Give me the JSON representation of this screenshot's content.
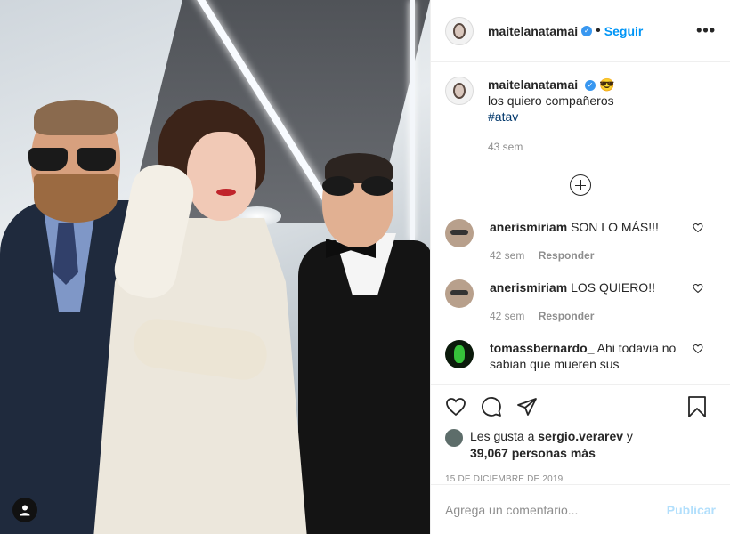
{
  "post": {
    "username": "maitelanatamai",
    "follow_label": "Seguir",
    "more_label": "•••",
    "caption_emoji": "😎",
    "caption_text": "los quiero compañeros",
    "hashtag": "#atav",
    "caption_time": "43 sem"
  },
  "comments": [
    {
      "username": "anerismiriam",
      "text": "SON LO MÁS!!!",
      "time": "42 sem",
      "reply_label": "Responder"
    },
    {
      "username": "anerismiriam",
      "text": "LOS QUIERO!!",
      "time": "42 sem",
      "reply_label": "Responder"
    },
    {
      "username": "tomassbernardo_",
      "text": "Ahi todavia no sabian que mueren sus",
      "time": "",
      "reply_label": ""
    }
  ],
  "likes": {
    "prefix": "Les gusta a",
    "liker": "sergio.verarev",
    "connector": "y",
    "count": "39,067 personas más"
  },
  "date": "15 DE DICIEMBRE DE 2019",
  "add_comment": {
    "placeholder": "Agrega un comentario...",
    "publish_label": "Publicar"
  },
  "icons": [
    "heart-icon",
    "comment-icon",
    "share-icon",
    "bookmark-icon",
    "user-tag-icon",
    "plus-circle-icon",
    "verified-icon"
  ],
  "colors": {
    "accent": "#0095f6",
    "verified": "#3897f0",
    "publish_disabled": "#b2dffc",
    "meta": "#8e8e8e"
  }
}
